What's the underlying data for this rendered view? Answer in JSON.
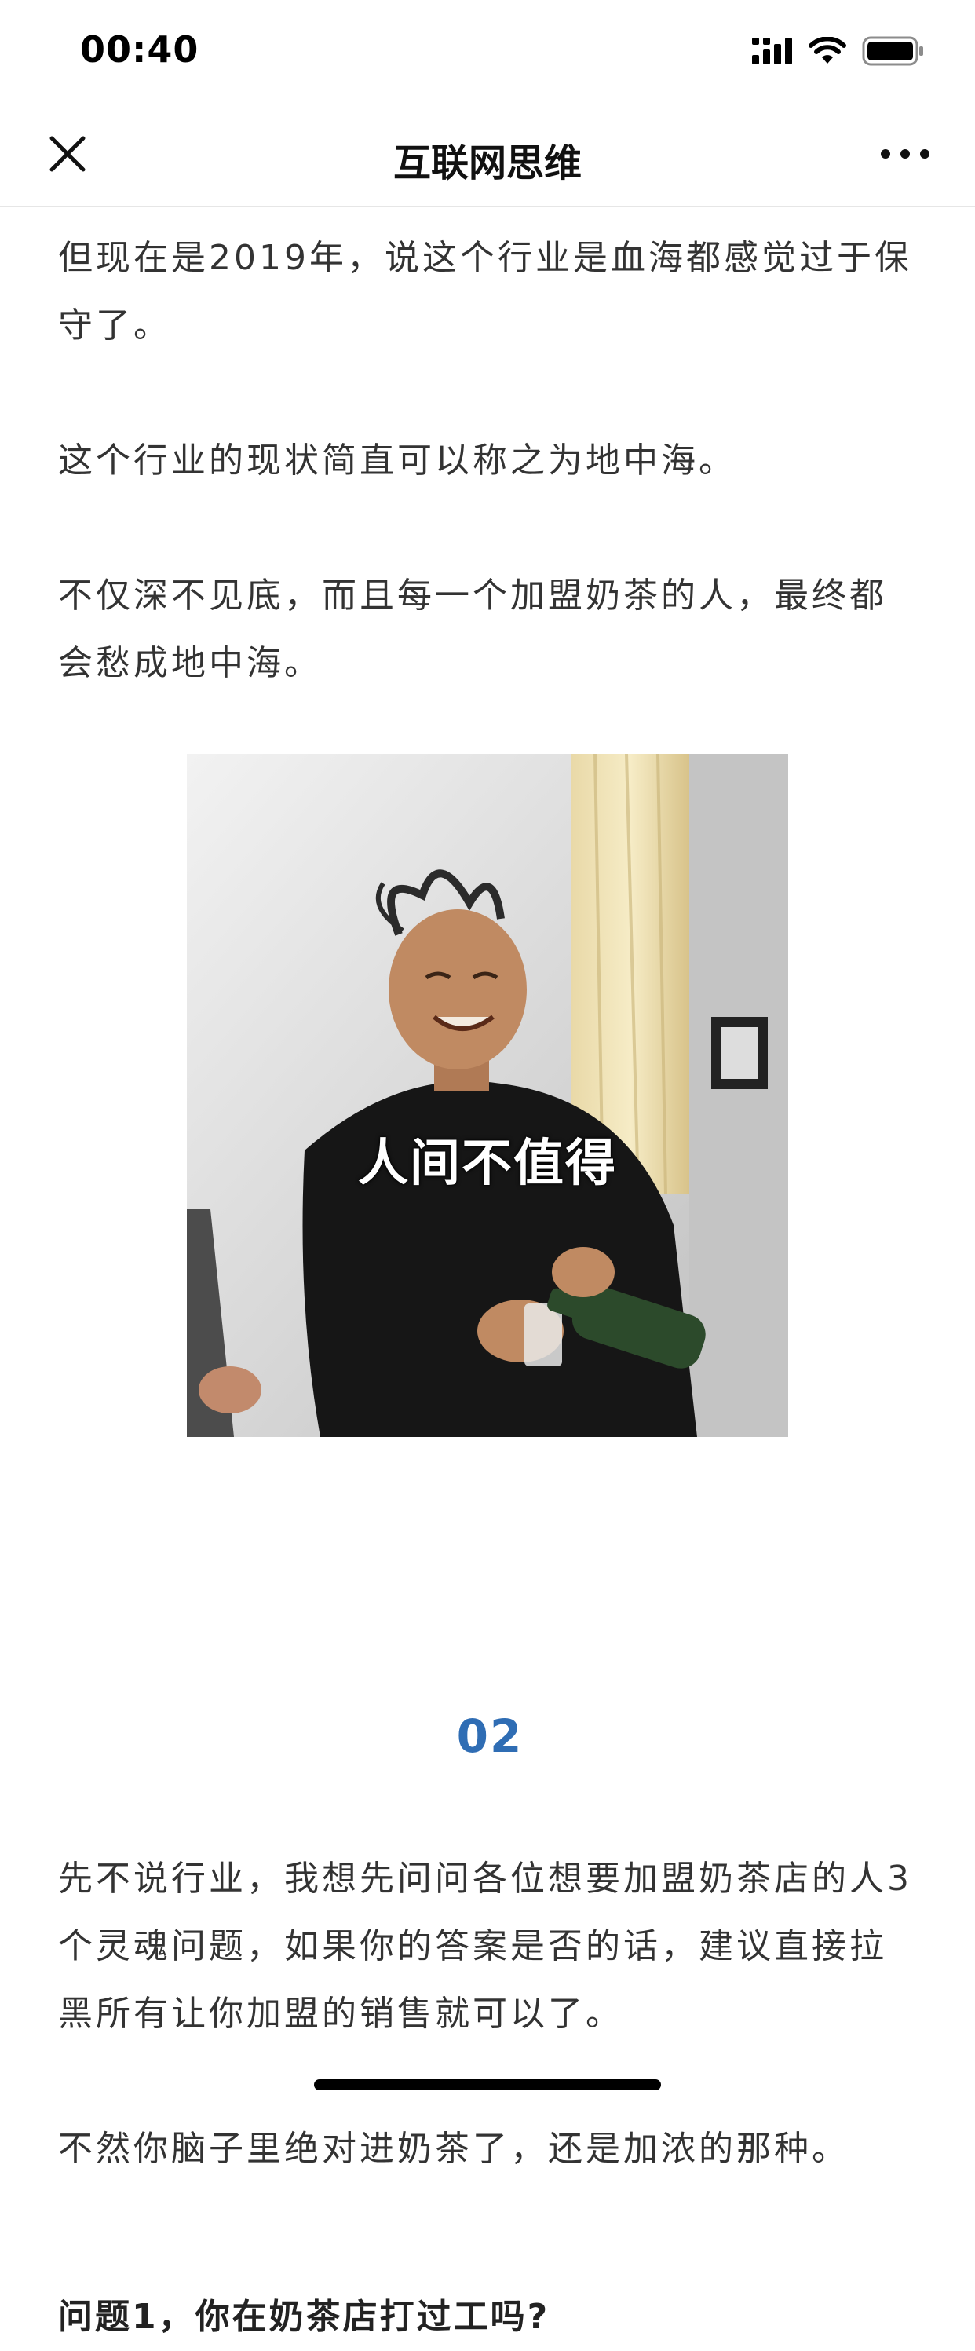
{
  "status_bar": {
    "time": "00:40",
    "icons": [
      "signal-icon",
      "wifi-icon",
      "battery-icon"
    ]
  },
  "nav": {
    "title": "互联网思维",
    "close_icon": "close-icon",
    "more_icon": "more-icon"
  },
  "article": {
    "paragraph_1": "但现在是2019年，说这个行业是血海都感觉过于保守了。",
    "paragraph_2": "这个行业的现状简直可以称之为地中海。",
    "paragraph_3": "不仅深不见底，而且每一个加盟奶茶的人，最终都会愁成地中海。",
    "meme_caption": "人间不值得",
    "section_number": "02",
    "paragraph_4": "先不说行业，我想先问问各位想要加盟奶茶店的人3个灵魂问题，如果你的答案是否的话，建议直接拉黑所有让你加盟的销售就可以了。",
    "paragraph_5": "不然你脑子里绝对进奶茶了，还是加浓的那种。",
    "question_1": "问题1，你在奶茶店打过工吗?"
  },
  "colors": {
    "section_number": "#2f6db4",
    "body_text": "#333333"
  }
}
